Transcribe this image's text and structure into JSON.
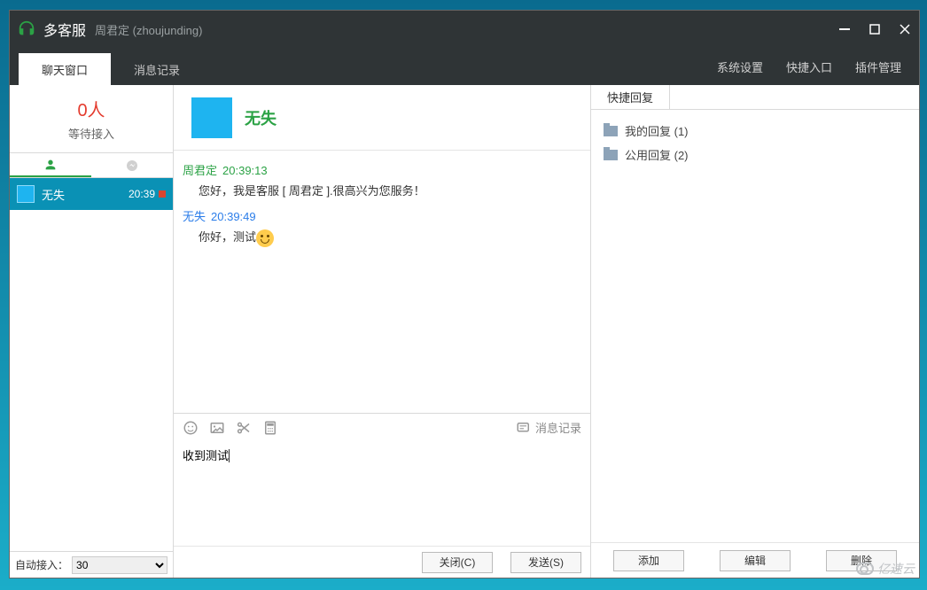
{
  "titlebar": {
    "app_name": "多客服",
    "subtitle": "周君定 (zhoujunding)"
  },
  "tabs": {
    "chat_window": "聊天窗口",
    "message_log": "消息记录",
    "menu": {
      "settings": "系统设置",
      "quick_entry": "快捷入口",
      "plugins": "插件管理"
    }
  },
  "waiting": {
    "count": "0人",
    "label": "等待接入"
  },
  "session": {
    "name": "无失",
    "time": "20:39"
  },
  "auto_accept": {
    "label": "自动接入：",
    "value": "30"
  },
  "chat": {
    "contact_name": "无失",
    "messages": [
      {
        "sender": "周君定",
        "type": "agent",
        "time": "20:39:13",
        "text": "您好，我是客服 [ 周君定 ].很高兴为您服务！"
      },
      {
        "sender": "无失",
        "type": "user",
        "time": "20:39:49",
        "text": "你好，测试"
      }
    ],
    "input_value": "收到测试",
    "history_link": "消息记录",
    "buttons": {
      "close": "关闭(C)",
      "send": "发送(S)"
    }
  },
  "quick_reply": {
    "header": "快捷回复",
    "folders": [
      {
        "name": "我的回复 (1)"
      },
      {
        "name": "公用回复 (2)"
      }
    ],
    "actions": {
      "add": "添加",
      "edit": "编辑",
      "delete": "删除"
    }
  },
  "watermark": "亿速云"
}
